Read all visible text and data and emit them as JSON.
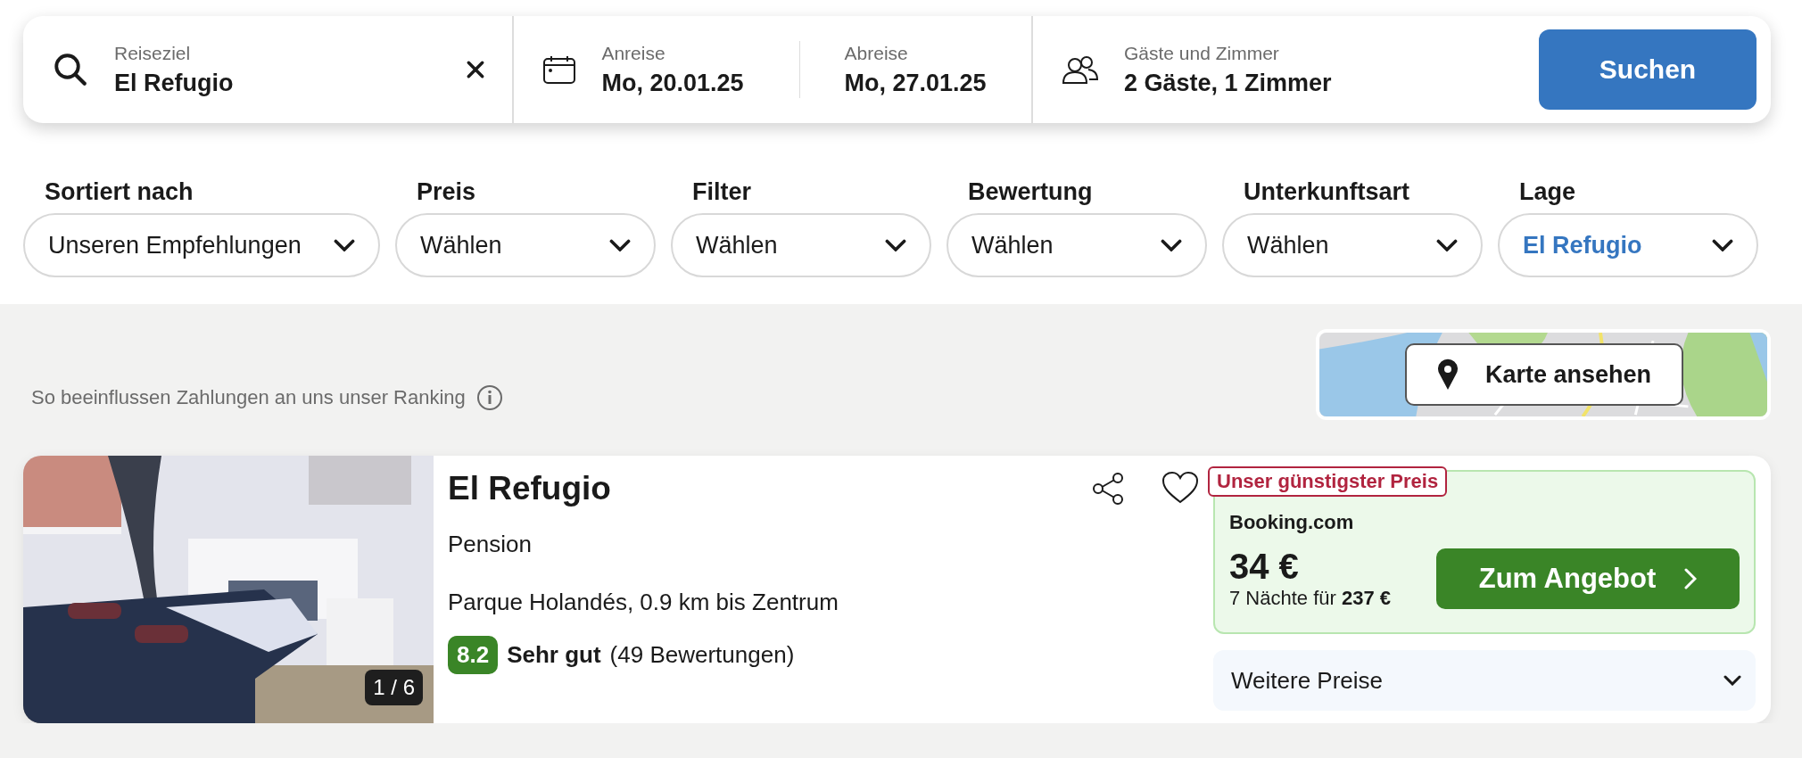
{
  "search_bar": {
    "destination": {
      "label": "Reiseziel",
      "value": "El Refugio"
    },
    "dates": [
      {
        "label": "Anreise",
        "value": "Mo, 20.01.25"
      },
      {
        "label": "Abreise",
        "value": "Mo, 27.01.25"
      }
    ],
    "guests": {
      "label": "Gäste und Zimmer",
      "value": "2 Gäste, 1 Zimmer"
    },
    "button": "Suchen"
  },
  "filters": [
    {
      "label": "Sortiert nach",
      "value": "Unseren Empfehlungen",
      "active": false
    },
    {
      "label": "Preis",
      "value": "Wählen",
      "active": false
    },
    {
      "label": "Filter",
      "value": "Wählen",
      "active": false
    },
    {
      "label": "Bewertung",
      "value": "Wählen",
      "active": false
    },
    {
      "label": "Unterkunftsart",
      "value": "Wählen",
      "active": false
    },
    {
      "label": "Lage",
      "value": "El Refugio",
      "active": true
    }
  ],
  "ranking_note": "So beeinflussen Zahlungen an uns unser Ranking",
  "map": {
    "kind": "picture",
    "button": "Karte ansehen"
  },
  "result": {
    "photo": {
      "kind": "picture",
      "counter": "1 / 6"
    },
    "title": "El Refugio",
    "type": "Pension",
    "location": "Parque Holandés, 0.9 km bis Zentrum",
    "rating": {
      "score": "8.2",
      "label": "Sehr gut",
      "count": "(49 Bewertungen)"
    },
    "favorite": false,
    "offer": {
      "badge": "Unser günstigster Preis",
      "provider": "Booking.com",
      "price": "34 €",
      "total": "7 Nächte für **237 €**",
      "button": "Zum Angebot"
    },
    "more_prices": "Weitere Preise"
  }
}
